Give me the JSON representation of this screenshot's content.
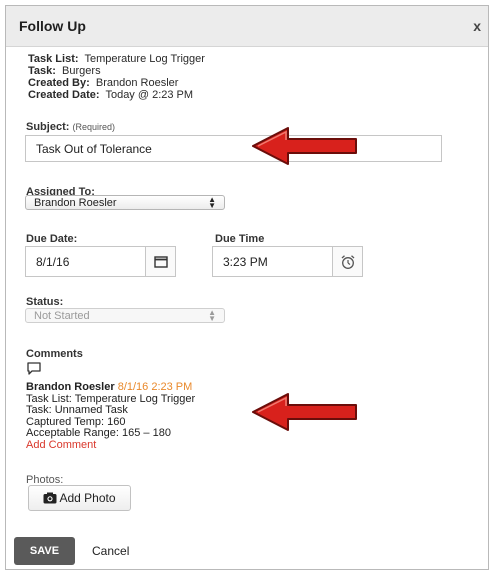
{
  "dialog": {
    "title": "Follow Up",
    "close_label": "x"
  },
  "meta": {
    "task_list_label": "Task List:",
    "task_list_value": "Temperature Log Trigger",
    "task_label": "Task:",
    "task_value": "Burgers",
    "created_by_label": "Created By:",
    "created_by_value": "Brandon Roesler",
    "created_date_label": "Created Date:",
    "created_date_value": "Today @ 2:23 PM"
  },
  "subject": {
    "label": "Subject:",
    "required_note": "(Required)",
    "value": "Task Out of Tolerance"
  },
  "assigned_to": {
    "label": "Assigned To:",
    "selected": "Brandon Roesler"
  },
  "due_date": {
    "label": "Due Date:",
    "value": "8/1/16"
  },
  "due_time": {
    "label": "Due Time",
    "value": "3:23 PM"
  },
  "status": {
    "label": "Status:",
    "selected": "Not Started"
  },
  "comments": {
    "label": "Comments",
    "author": "Brandon Roesler",
    "timestamp": "8/1/16 2:23 PM",
    "lines": [
      "Task List: Temperature Log Trigger",
      "Task: Unnamed Task",
      "Captured Temp: 160",
      "Acceptable Range: 165 – 180"
    ],
    "add_comment_label": "Add Comment"
  },
  "photos": {
    "label": "Photos:",
    "add_photo_label": "Add Photo"
  },
  "footer": {
    "save_label": "SAVE",
    "cancel_label": "Cancel"
  },
  "colors": {
    "arrow_red": "#d8211c",
    "timestamp_orange": "#e9892b",
    "link_red": "#d9372b",
    "save_bg": "#5a5a5a"
  },
  "icons": {
    "calendar": "calendar-icon",
    "clock": "alarm-clock-icon",
    "comment": "speech-bubble-icon",
    "camera": "camera-icon",
    "select_arrows": "up-down-arrows-icon"
  }
}
